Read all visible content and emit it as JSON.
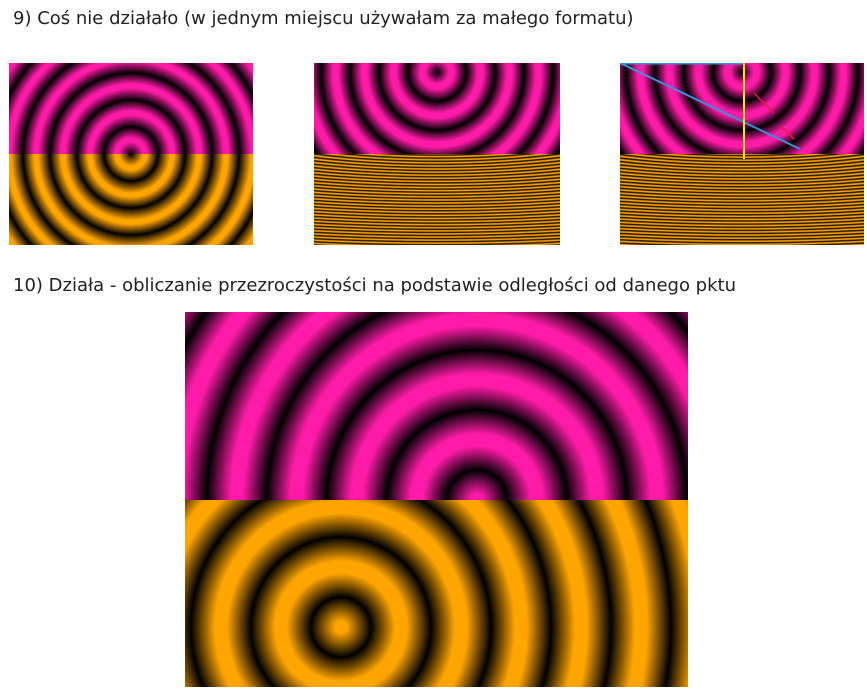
{
  "section9": {
    "heading": "9) Coś nie działało (w jednym miejscu używałam za małego formatu)"
  },
  "section10": {
    "heading": "10) Działa - obliczanie przezroczystości na podstawie odległości od danego pktu"
  },
  "colors": {
    "pink": "#ff1aa8",
    "orange": "#ffa500",
    "blue": "#3b8fd8",
    "yellow": "#ffe600",
    "red": "#e0202a"
  }
}
